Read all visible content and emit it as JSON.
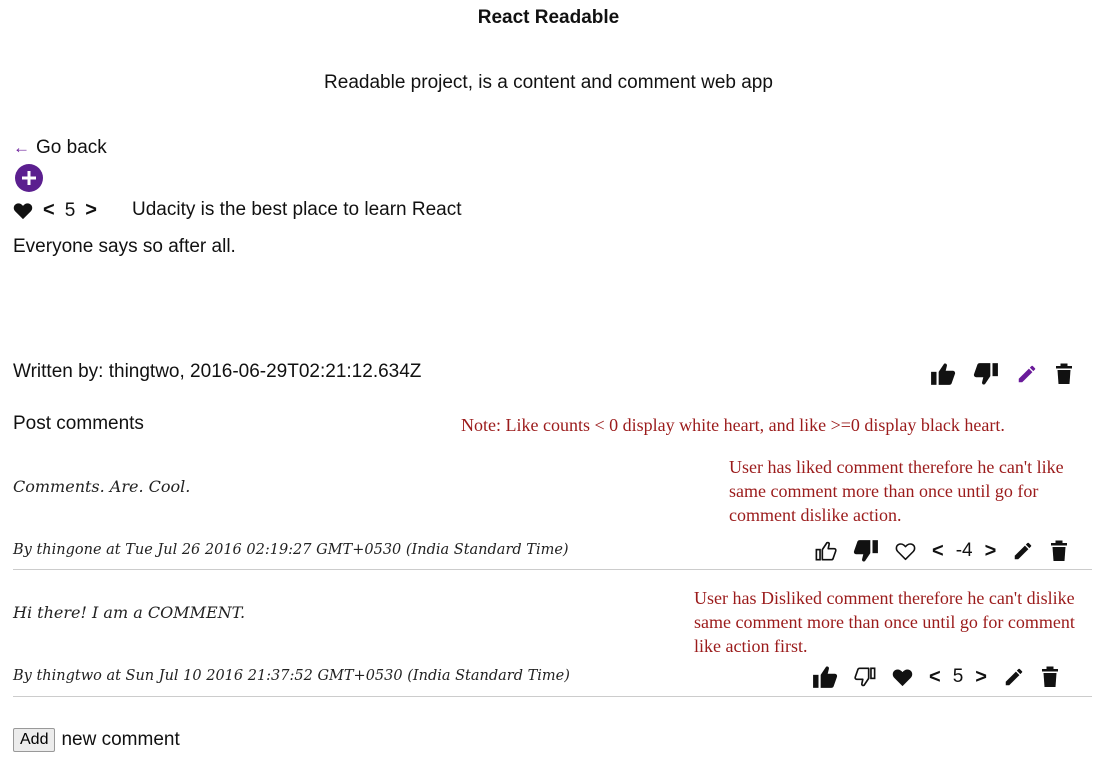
{
  "header": {
    "title": "React Readable",
    "subtitle": "Readable project, is a content and comment web app"
  },
  "nav": {
    "back_label": "Go back",
    "back_arrow": "←"
  },
  "post": {
    "vote_count": "5",
    "title": "Udacity is the best place to learn React",
    "body": "Everyone says so after all.",
    "meta": "Written by: thingtwo, 2016-06-29T02:21:12.634Z",
    "chev_left": "<",
    "chev_right": ">"
  },
  "comments": {
    "heading": "Post comments",
    "items": [
      {
        "body": "Comments. Are. Cool.",
        "meta": "By thingone at Tue Jul 26 2016 02:19:27 GMT+0530 (India Standard Time)",
        "vote_count": "-4",
        "liked": true,
        "disliked": false,
        "heart": "white"
      },
      {
        "body": "Hi there! I am a COMMENT.",
        "meta": "By thingtwo at Sun Jul 10 2016 21:37:52 GMT+0530 (India Standard Time)",
        "vote_count": "5",
        "liked": false,
        "disliked": true,
        "heart": "black"
      }
    ]
  },
  "notes": {
    "heart": "Note: Like counts < 0 display white heart, and like >=0 display black heart.",
    "liked": "User has liked comment therefore he can't like same comment more than once until go for comment dislike action.",
    "disliked": "User has Disliked comment therefore he can't dislike same comment more than once until go for comment like action first."
  },
  "add_comment": {
    "button_label": "Add",
    "text": "new comment"
  },
  "colors": {
    "accent": "#5b1f8f",
    "note": "#9b1b1b"
  }
}
